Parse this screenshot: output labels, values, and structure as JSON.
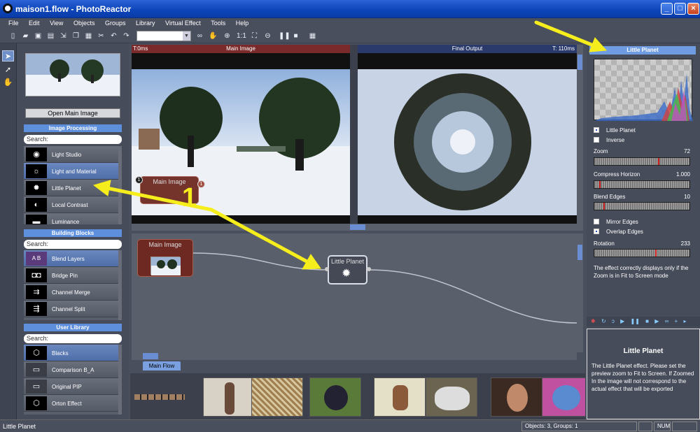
{
  "window": {
    "title": "maison1.flow - PhotoReactor",
    "minimize": "_",
    "maximize": "□",
    "close": "×"
  },
  "menu": [
    "File",
    "Edit",
    "View",
    "Objects",
    "Groups",
    "Library",
    "Virtual Effect",
    "Tools",
    "Help"
  ],
  "toolbar": {
    "zoom_label": "1:1"
  },
  "left_panel": {
    "open_button": "Open Main Image",
    "image_processing": {
      "header": "Image Processing",
      "search": "Search:",
      "items": [
        {
          "label": "Light Studio",
          "icon": "spotlight-icon",
          "glyph": "◉"
        },
        {
          "label": "Light and Material",
          "icon": "bulb-icon",
          "glyph": "☼"
        },
        {
          "label": "Little Planet",
          "icon": "gear-icon",
          "glyph": "✹"
        },
        {
          "label": "Local Contrast",
          "icon": "contrast-icon",
          "glyph": "◐"
        },
        {
          "label": "Luminance",
          "icon": "luminance-icon",
          "glyph": "▬"
        }
      ],
      "selected": 1
    },
    "building_blocks": {
      "header": "Building Blocks",
      "search": "Search:",
      "items": [
        {
          "label": "Blend Layers",
          "icon": "blend-icon",
          "glyph": "A B"
        },
        {
          "label": "Bridge Pin",
          "icon": "bridge-icon",
          "glyph": "◘◘"
        },
        {
          "label": "Channel Merge",
          "icon": "merge-icon",
          "glyph": "⇉"
        },
        {
          "label": "Channel Split",
          "icon": "split-icon",
          "glyph": "⇶"
        }
      ],
      "selected": 0
    },
    "user_library": {
      "header": "User Library",
      "search": "Search:",
      "items": [
        {
          "label": "Blacks",
          "icon": "cube-icon",
          "glyph": "⬡"
        },
        {
          "label": "Comparison B_A",
          "icon": "device-icon",
          "glyph": "▭"
        },
        {
          "label": "Original PIP",
          "icon": "device-icon",
          "glyph": "▭"
        },
        {
          "label": "Orton Effect",
          "icon": "cube-icon",
          "glyph": "⬡"
        }
      ],
      "selected": 0
    }
  },
  "viewer_left": {
    "time": "T:0ms",
    "title": "Main Image",
    "badge": "1",
    "node_title": "Main Image",
    "node_badge": "1"
  },
  "viewer_right": {
    "title": "Final Output",
    "time": "T: 110ms"
  },
  "flow": {
    "tab": "Main Flow",
    "nodes": [
      {
        "title": "Main Image"
      },
      {
        "title": "Little Planet"
      }
    ]
  },
  "annotation": {
    "number": "1",
    "color": "#f6ee1c"
  },
  "right_panel": {
    "title": "Little Planet",
    "checkboxes": [
      {
        "label": "Little Planet",
        "checked": true
      },
      {
        "label": "Inverse",
        "checked": false
      }
    ],
    "sliders": [
      {
        "label": "Zoom",
        "value": "72",
        "level": 0.68
      },
      {
        "label": "Compress Horizon",
        "value": "1.000",
        "level": 0.05
      },
      {
        "label": "Blend Edges",
        "value": "10",
        "level": 0.1
      }
    ],
    "checkboxes2": [
      {
        "label": "Mirror Edges",
        "checked": false
      },
      {
        "label": "Overlap Edges",
        "checked": true
      }
    ],
    "rotation": {
      "label": "Rotation",
      "value": "233",
      "level": 0.65
    },
    "note": "The effect correctly displays only if the Zoom is in Fit to Screen mode"
  },
  "help": {
    "title": "Little Planet",
    "text": "The Little Planet effect. Please set the preview zoom to Fit to Screen. If Zoomed In the image will not correspond to the actual effect that will be exported"
  },
  "status": {
    "text": "Little Planet",
    "counts": "Objects: 3, Groups: 1",
    "num": "NUM"
  },
  "colors": {
    "accent": "#5d8fdc",
    "node_red": "#6e2a22",
    "panel": "#474c5a"
  }
}
